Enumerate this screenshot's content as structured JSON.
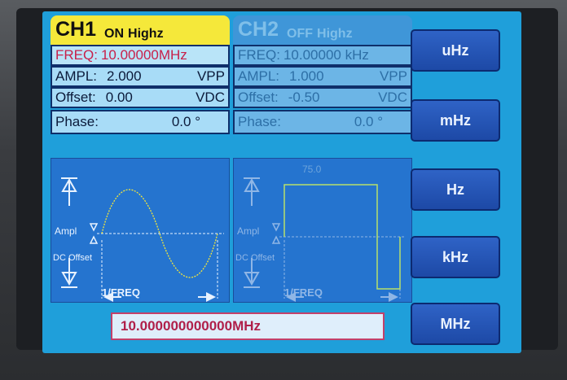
{
  "ch1": {
    "name": "CH1",
    "state": "ON",
    "impedance": "Highz",
    "freq_label": "FREQ:",
    "freq_value": "10.00000MHz",
    "ampl_label": "AMPL:",
    "ampl_value": "2.000",
    "ampl_unit": "VPP",
    "offset_label": "Offset:",
    "offset_value": "0.00",
    "offset_unit": "VDC",
    "phase_label": "Phase:",
    "phase_value": "0.0 °",
    "wave_ampl": "Ampl",
    "wave_dc": "DC Offset",
    "wave_freq": "1/FREQ"
  },
  "ch2": {
    "name": "CH2",
    "state": "OFF",
    "impedance": "Highz",
    "freq_label": "FREQ:",
    "freq_value": "10.00000 kHz",
    "ampl_label": "AMPL:",
    "ampl_value": "1.000",
    "ampl_unit": "VPP",
    "offset_label": "Offset:",
    "offset_value": "-0.50",
    "offset_unit": "VDC",
    "phase_label": "Phase:",
    "phase_value": "0.0 °",
    "duty_value": "75.0",
    "wave_ampl": "Ampl",
    "wave_dc": "DC Offset",
    "wave_freq": "1/FREQ"
  },
  "unit_buttons": [
    "uHz",
    "mHz",
    "Hz",
    "kHz",
    "MHz"
  ],
  "entry_value": "10.000000000000MHz",
  "colors": {
    "screen": "#1f9fda",
    "ch1_title": "#f5e83a",
    "ch2_title": "#3f96d8",
    "freq_text": "#c8204a",
    "wave_bg": "#2574cf"
  }
}
